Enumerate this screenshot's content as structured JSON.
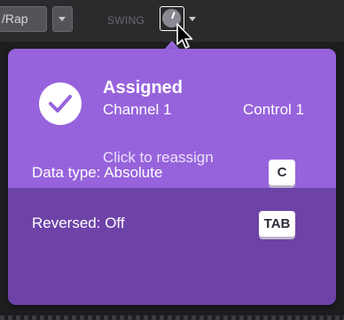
{
  "toolbar": {
    "preset_value": "/Rap",
    "preset_dropdown_icon": "chevron-down-icon",
    "swing_label": "SWING",
    "knob_icon": "knob-icon",
    "knob_dropdown_icon": "chevron-down-icon"
  },
  "popover": {
    "status_icon": "check-circle-icon",
    "title": "Assigned",
    "channel": "Channel 1",
    "control": "Control 1",
    "reassign_link": "Click to reassign",
    "data_type_label": "Data type: Absolute",
    "data_type_shortcut": "C",
    "reversed_label": "Reversed: Off",
    "reversed_shortcut": "TAB"
  },
  "colors": {
    "popover_top": "#9763dc",
    "popover_bottom": "#6e43a8",
    "toolbar_bg": "#2b2b2e",
    "app_bg": "#1e1e21"
  }
}
